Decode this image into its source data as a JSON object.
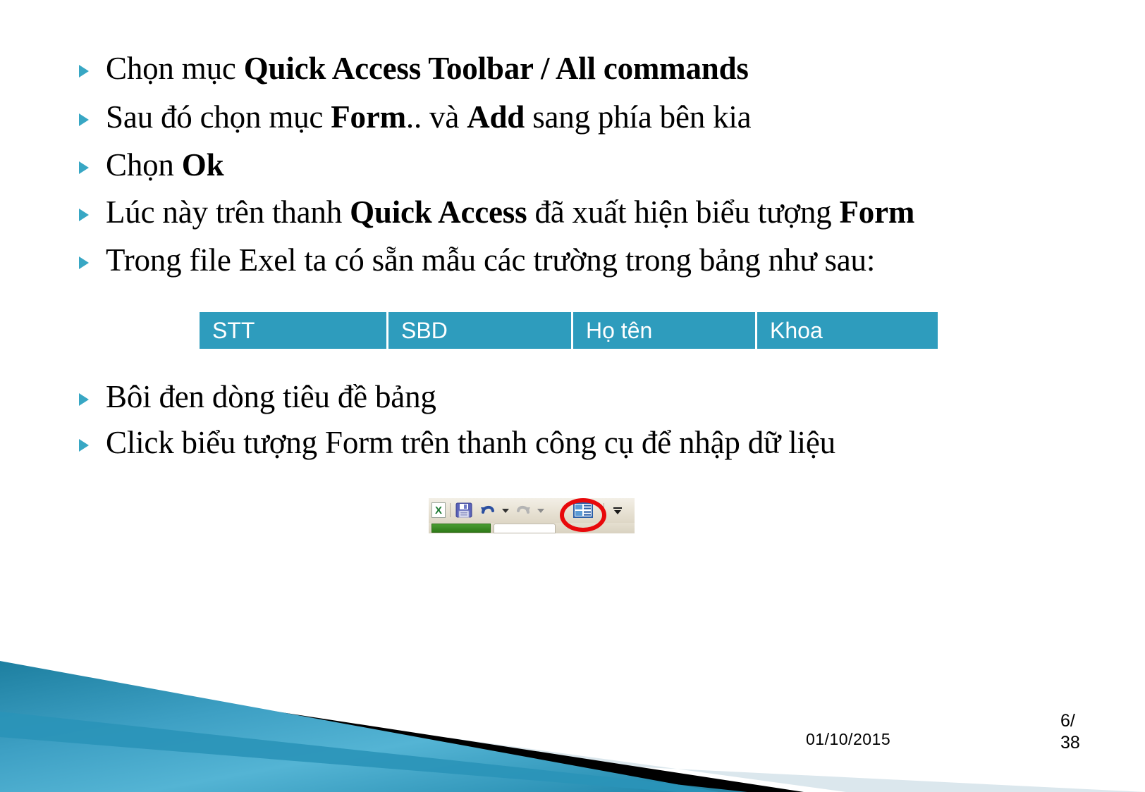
{
  "slide": {
    "background_color": "#ffffff",
    "accent_color": "#2E9CBD",
    "bullet_marker_color": "#38A7C4"
  },
  "bullets_top": [
    {
      "id": "bullet-quick-access-toolbar",
      "parts": [
        {
          "text": "Chọn mục ",
          "bold": false
        },
        {
          "text": "Quick Access Toolbar / All commands",
          "bold": true
        }
      ]
    },
    {
      "id": "bullet-form-add",
      "parts": [
        {
          "text": "Sau đó chọn mục ",
          "bold": false
        },
        {
          "text": "Form",
          "bold": true
        },
        {
          "text": ".. và ",
          "bold": false
        },
        {
          "text": "Add",
          "bold": true
        },
        {
          "text": " sang phía bên kia",
          "bold": false
        }
      ]
    },
    {
      "id": "bullet-chon-ok",
      "parts": [
        {
          "text": "Chọn ",
          "bold": false
        },
        {
          "text": "Ok",
          "bold": true
        }
      ]
    },
    {
      "id": "bullet-quick-access-form-icon",
      "parts": [
        {
          "text": "Lúc này trên thanh ",
          "bold": false
        },
        {
          "text": "Quick Access",
          "bold": true
        },
        {
          "text": " đã xuất hiện biểu tượng ",
          "bold": false
        },
        {
          "text": "Form",
          "bold": true
        }
      ]
    },
    {
      "id": "bullet-exel-sample-fields",
      "parts": [
        {
          "text": "Trong file Exel ta có sẵn mẫu các trường trong bảng như sau:",
          "bold": false
        }
      ]
    }
  ],
  "field_table": {
    "headers": [
      "STT",
      "SBD",
      "Họ tên",
      "Khoa"
    ],
    "header_background": "#2E9CBD",
    "header_text_color": "#ffffff"
  },
  "bullets_bottom": [
    {
      "id": "bullet-boi-den-dong-tieu-de",
      "parts": [
        {
          "text": "Bôi đen dòng tiêu đề bảng",
          "bold": false
        }
      ]
    },
    {
      "id": "bullet-click-form-icon",
      "parts": [
        {
          "text": "Click biểu tượng Form trên thanh công cụ để nhập dữ liệu",
          "bold": false
        }
      ]
    }
  ],
  "excel_toolbar_figure": {
    "caption": "",
    "icons": [
      {
        "name": "excel-logo-icon",
        "label": "X"
      },
      {
        "name": "save-icon",
        "label": "Save"
      },
      {
        "name": "undo-icon",
        "label": "Undo"
      },
      {
        "name": "undo-dropdown-icon",
        "label": "Undo options"
      },
      {
        "name": "redo-icon",
        "label": "Redo"
      },
      {
        "name": "redo-dropdown-icon",
        "label": "Redo options"
      },
      {
        "name": "form-icon",
        "label": "Form"
      },
      {
        "name": "customize-quick-access-toolbar-icon",
        "label": "Customize Quick Access Toolbar"
      }
    ],
    "highlight": {
      "name": "red-circle-annotation",
      "color": "#e8080b",
      "target": "form-icon"
    }
  },
  "footer": {
    "date": "01/10/2015",
    "page_current": "6/",
    "page_total": "38"
  }
}
